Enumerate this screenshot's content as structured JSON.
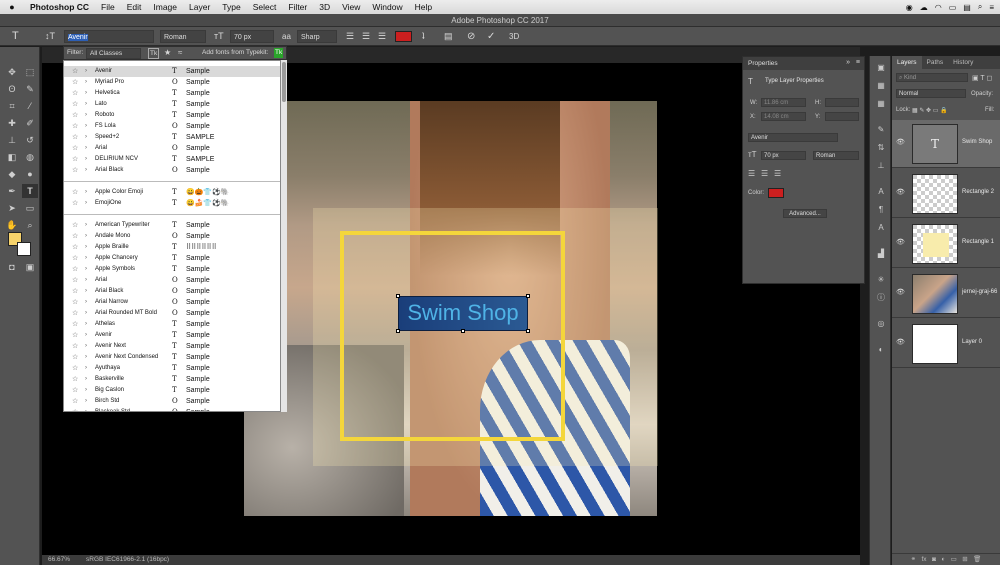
{
  "menubar": {
    "app": "Photoshop CC",
    "items": [
      "File",
      "Edit",
      "Image",
      "Layer",
      "Type",
      "Select",
      "Filter",
      "3D",
      "View",
      "Window",
      "Help"
    ]
  },
  "window_title": "Adobe Photoshop CC 2017",
  "options": {
    "font_family": "Avenir",
    "font_style": "Roman",
    "font_size": "70 px",
    "antialias": "Sharp",
    "color": "#cc1f1f"
  },
  "font_menu": {
    "filter_label": "Filter:",
    "filter_value": "All Classes",
    "typekit_label": "Add fonts from Typekit:",
    "sample": "Sample",
    "recent": [
      {
        "name": "Avenir",
        "type": "T",
        "sample": "Sample"
      },
      {
        "name": "Myriad Pro",
        "type": "O",
        "sample": "Sample"
      },
      {
        "name": "Helvetica",
        "type": "T",
        "sample": "Sample"
      },
      {
        "name": "Lato",
        "type": "T",
        "sample": "Sample"
      },
      {
        "name": "Roboto",
        "type": "T",
        "sample": "Sample"
      },
      {
        "name": "FS Lola",
        "type": "O",
        "sample": "Sample"
      },
      {
        "name": "Speed+2",
        "type": "T",
        "sample": "SAMPLE"
      },
      {
        "name": "Arial",
        "type": "O",
        "sample": "Sample"
      },
      {
        "name": "DELIRIUM NCV",
        "type": "T",
        "sample": "SAMPLE"
      },
      {
        "name": "Arial Black",
        "type": "O",
        "sample": "Sample"
      }
    ],
    "emoji": [
      {
        "name": "Apple Color Emoji",
        "type": "T",
        "sample": "😀🎃👕⚽🐘"
      },
      {
        "name": "EmojiOne",
        "type": "T",
        "sample": "😀🍰👕⚽🐘"
      }
    ],
    "all": [
      {
        "name": "American Typewriter",
        "type": "T",
        "sample": "Sample"
      },
      {
        "name": "Andale Mono",
        "type": "O",
        "sample": "Sample"
      },
      {
        "name": "Apple Braille",
        "type": "T",
        "sample": "⠿⠿⠿⠿⠿⠿"
      },
      {
        "name": "Apple Chancery",
        "type": "T",
        "sample": "Sample"
      },
      {
        "name": "Apple Symbols",
        "type": "T",
        "sample": "Sample"
      },
      {
        "name": "Arial",
        "type": "O",
        "sample": "Sample"
      },
      {
        "name": "Arial Black",
        "type": "O",
        "sample": "Sample"
      },
      {
        "name": "Arial Narrow",
        "type": "O",
        "sample": "Sample"
      },
      {
        "name": "Arial Rounded MT Bold",
        "type": "O",
        "sample": "Sample"
      },
      {
        "name": "Athelas",
        "type": "T",
        "sample": "Sample"
      },
      {
        "name": "Avenir",
        "type": "T",
        "sample": "Sample"
      },
      {
        "name": "Avenir Next",
        "type": "T",
        "sample": "Sample"
      },
      {
        "name": "Avenir Next Condensed",
        "type": "T",
        "sample": "Sample"
      },
      {
        "name": "Ayuthaya",
        "type": "T",
        "sample": "Sample"
      },
      {
        "name": "Baskerville",
        "type": "T",
        "sample": "Sample"
      },
      {
        "name": "Big Caslon",
        "type": "T",
        "sample": "Sample"
      },
      {
        "name": "Birch Std",
        "type": "O",
        "sample": "Sample"
      },
      {
        "name": "Blackoak Std",
        "type": "O",
        "sample": "Sample"
      }
    ]
  },
  "canvas": {
    "text": "Swim Shop"
  },
  "status": {
    "zoom": "66.67%",
    "profile": "sRGB IEC61966-2.1 (16bpc)"
  },
  "properties": {
    "title": "Properties",
    "subtitle": "Type Layer Properties",
    "w": "W:",
    "w_val": "11.86 cm",
    "h": "H:",
    "x": "X:",
    "x_val": "14.08 cm",
    "y": "Y:",
    "font": "Avenir",
    "size": "70 px",
    "style": "Roman",
    "color_label": "Color:",
    "color": "#cc1f1f",
    "advanced": "Advanced..."
  },
  "layers": {
    "tabs": [
      "Layers",
      "Paths",
      "History"
    ],
    "kind": "Kind",
    "blend": "Normal",
    "opacity_label": "Opacity:",
    "lock_label": "Lock:",
    "fill_label": "Fill:",
    "items": [
      {
        "name": "Swim Shop"
      },
      {
        "name": "Rectangle 2"
      },
      {
        "name": "Rectangle 1"
      },
      {
        "name": "jernej-graj-66"
      },
      {
        "name": "Layer 0"
      }
    ]
  }
}
